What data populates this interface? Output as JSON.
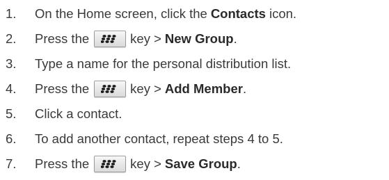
{
  "steps": [
    {
      "num": "1.",
      "pre": "On the Home screen, click the",
      "bold": "Contacts",
      "post": "icon."
    },
    {
      "num": "2.",
      "pre": "Press the",
      "key_icon": "blackberry-menu-key-icon",
      "mid": "key >",
      "bold": "New Group",
      "post": "."
    },
    {
      "num": "3.",
      "text": "Type a name for the personal distribution list."
    },
    {
      "num": "4.",
      "pre": "Press the",
      "key_icon": "blackberry-menu-key-icon",
      "mid": "key >",
      "bold": "Add Member",
      "post": "."
    },
    {
      "num": "5.",
      "text": "Click a contact."
    },
    {
      "num": "6.",
      "text": "To add another contact, repeat steps 4 to 5."
    },
    {
      "num": "7.",
      "pre": "Press the",
      "key_icon": "blackberry-menu-key-icon",
      "mid": "key >",
      "bold": "Save Group",
      "post": "."
    }
  ],
  "colors": {
    "text": "#3a3a3a",
    "key_border": "#9a9a9a",
    "key_background": "#e8e8e8"
  }
}
